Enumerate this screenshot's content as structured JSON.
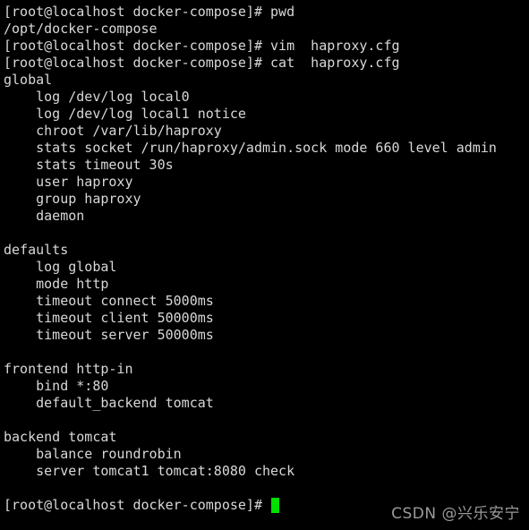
{
  "terminal": {
    "background_color": "#000000",
    "text_color": "#d8d8d8",
    "cursor_color": "#00e000",
    "lines": [
      "[root@localhost docker-compose]# pwd",
      "/opt/docker-compose",
      "[root@localhost docker-compose]# vim  haproxy.cfg",
      "[root@localhost docker-compose]# cat  haproxy.cfg",
      "global",
      "    log /dev/log local0",
      "    log /dev/log local1 notice",
      "    chroot /var/lib/haproxy",
      "    stats socket /run/haproxy/admin.sock mode 660 level admin",
      "    stats timeout 30s",
      "    user haproxy",
      "    group haproxy",
      "    daemon",
      "",
      "defaults",
      "    log global",
      "    mode http",
      "    timeout connect 5000ms",
      "    timeout client 50000ms",
      "    timeout server 50000ms",
      "",
      "frontend http-in",
      "    bind *:80",
      "    default_backend tomcat",
      "",
      "backend tomcat",
      "    balance roundrobin",
      "    server tomcat1 tomcat:8080 check",
      ""
    ],
    "final_prompt": "[root@localhost docker-compose]# "
  },
  "watermark": {
    "text": "CSDN @兴乐安宁",
    "color": "#9a9a9a"
  }
}
